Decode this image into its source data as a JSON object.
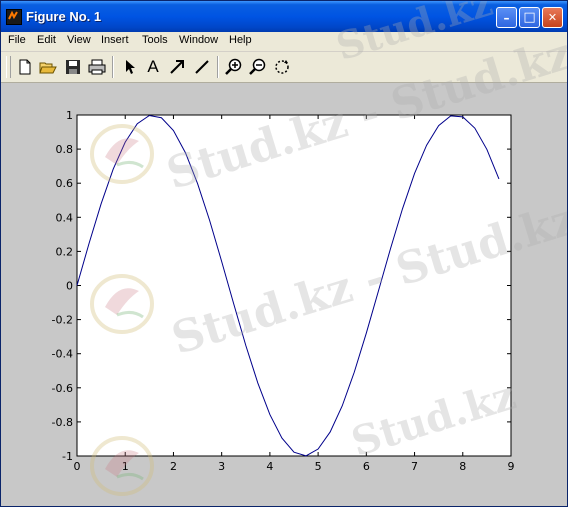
{
  "window": {
    "title": "Figure No. 1",
    "controls": {
      "minimize": "–",
      "maximize": "□",
      "close": "✕"
    }
  },
  "menu": {
    "items": [
      "File",
      "Edit",
      "View",
      "Insert",
      "Tools",
      "Window",
      "Help"
    ]
  },
  "toolbar": {
    "tools": [
      "new-file-icon",
      "open-folder-icon",
      "save-icon",
      "print-icon",
      "select-arrow-icon",
      "insert-text-icon",
      "insert-arrow-icon",
      "insert-line-icon",
      "zoom-in-icon",
      "zoom-out-icon",
      "rotate-3d-icon"
    ],
    "insert_text_glyph": "A"
  },
  "watermark": {
    "text": "Stud.kz - Stud.kz",
    "short": "Stud.kz"
  },
  "colors": {
    "titlebar": "#0054e3",
    "line": "#00008b",
    "menubar": "#ece9d8",
    "figure_bg": "#c8c8c8"
  },
  "chart_data": {
    "type": "line",
    "function": "sin(x)",
    "title": "",
    "xlabel": "",
    "ylabel": "",
    "xlim": [
      0,
      9
    ],
    "ylim": [
      -1,
      1
    ],
    "x_ticks": [
      0,
      1,
      2,
      3,
      4,
      5,
      6,
      7,
      8,
      9
    ],
    "y_ticks": [
      -1,
      -0.8,
      -0.6,
      -0.4,
      -0.2,
      0,
      0.2,
      0.4,
      0.6,
      0.8,
      1
    ],
    "y_tick_labels": [
      "-1",
      "-0.8",
      "-0.6",
      "-0.4",
      "-0.2",
      "0",
      "0.2",
      "0.4",
      "0.6",
      "0.8",
      "1"
    ],
    "x_tick_labels": [
      "0",
      "1",
      "2",
      "3",
      "4",
      "5",
      "6",
      "7",
      "8",
      "9"
    ],
    "series": [
      {
        "x": [
          0,
          0.25,
          0.5,
          0.75,
          1,
          1.25,
          1.5,
          1.75,
          2,
          2.25,
          2.5,
          2.75,
          3,
          3.25,
          3.5,
          3.75,
          4,
          4.25,
          4.5,
          4.75,
          5,
          5.25,
          5.5,
          5.75,
          6,
          6.25,
          6.5,
          6.75,
          7,
          7.25,
          7.5,
          7.75,
          8,
          8.25,
          8.5,
          8.75
        ],
        "y": [
          0,
          0.247,
          0.479,
          0.682,
          0.841,
          0.949,
          0.997,
          0.984,
          0.909,
          0.778,
          0.598,
          0.382,
          0.141,
          -0.108,
          -0.351,
          -0.572,
          -0.757,
          -0.895,
          -0.978,
          -0.999,
          -0.959,
          -0.859,
          -0.706,
          -0.508,
          -0.279,
          -0.033,
          0.215,
          0.45,
          0.657,
          0.823,
          0.938,
          0.995,
          0.989,
          0.923,
          0.798,
          0.625
        ]
      }
    ],
    "grid": false,
    "legend": false
  }
}
